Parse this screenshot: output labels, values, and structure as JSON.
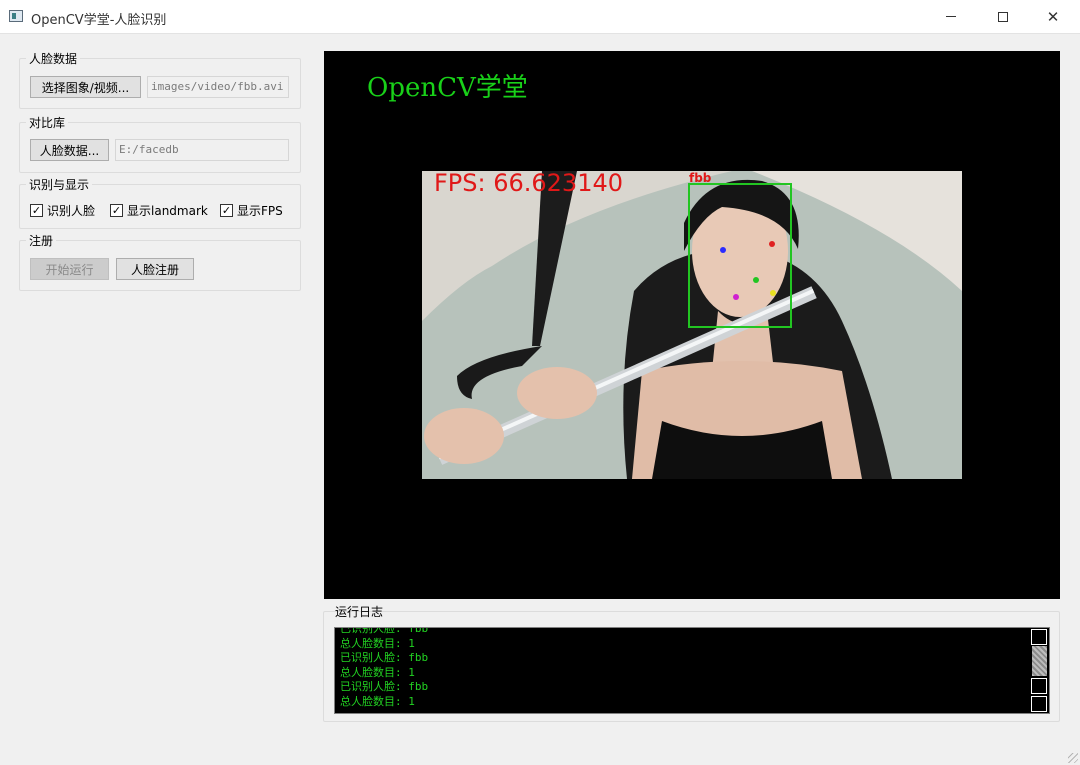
{
  "window": {
    "title": "OpenCV学堂-人脸识别",
    "controls": {
      "minimize_icon": "minimize-icon",
      "maximize_icon": "maximize-icon",
      "close_icon": "close-icon"
    }
  },
  "face_data_group": {
    "legend": "人脸数据",
    "select_button": "选择图象/视频...",
    "path_value": "images/video/fbb.avi"
  },
  "compare_group": {
    "legend": "对比库",
    "db_button": "人脸数据...",
    "db_path": "E:/facedb"
  },
  "display_group": {
    "legend": "识别与显示",
    "checkboxes": [
      {
        "label": "识别人脸",
        "checked": true
      },
      {
        "label": "显示landmark",
        "checked": true
      },
      {
        "label": "显示FPS",
        "checked": true
      }
    ]
  },
  "register_group": {
    "legend": "注册",
    "start_button": "开始运行",
    "start_enabled": false,
    "register_button": "人脸注册"
  },
  "video": {
    "overlay_title": "OpenCV学堂",
    "fps_text": "FPS: 66.623140",
    "face_label": "fbb"
  },
  "log": {
    "label": "运行日志",
    "lines": [
      "已识别人脸: fbb",
      "总人脸数目: 1",
      "已识别人脸: fbb",
      "总人脸数目: 1",
      "已识别人脸: fbb",
      "总人脸数目: 1"
    ]
  },
  "colors": {
    "overlay_green": "#19d119",
    "fps_red": "#e01818",
    "face_box_green": "#22c522",
    "log_text_green": "#22d322"
  }
}
